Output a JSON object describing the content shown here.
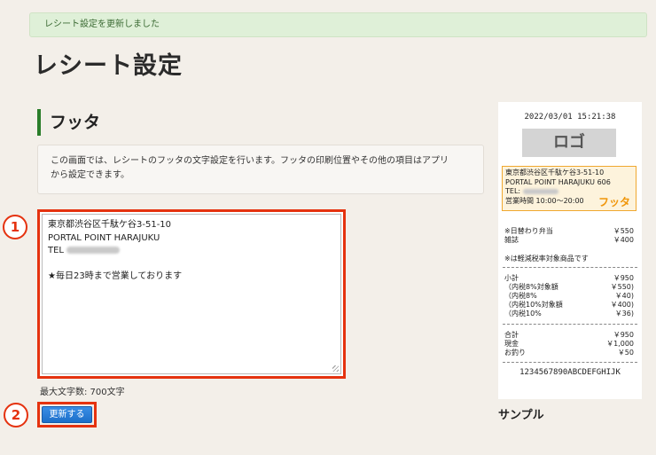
{
  "flash": {
    "message": "レシート設定を更新しました"
  },
  "page": {
    "title": "レシート設定"
  },
  "section": {
    "title": "フッタ",
    "description_line1": "この画面では、レシートのフッタの文字設定を行います。フッタの印刷位置やその他の項目はアプリ",
    "description_line2": "から設定できます。"
  },
  "footer_text": {
    "line1": "東京都渋谷区千駄ケ谷3-51-10",
    "line2": "PORTAL POINT HARAJUKU",
    "line3_prefix": "TEL",
    "line4": "",
    "line5": "★毎日23時まで営業しております",
    "max_chars_label": "最大文字数: 700文字"
  },
  "buttons": {
    "update": "更新する"
  },
  "annotations": {
    "badge1": "1",
    "badge2": "2"
  },
  "receipt": {
    "datetime": "2022/03/01 15:21:38",
    "logo": "ロゴ",
    "footer_line1": "東京都渋谷区千駄ケ谷3-51-10",
    "footer_line2": "PORTAL POINT HARAJUKU 606",
    "footer_line3": "TEL:",
    "footer_line4": "営業時間 10:00～20:00",
    "footer_tag": "フッタ",
    "items": [
      {
        "name": "※日替わり弁当",
        "price": "￥550"
      },
      {
        "name": "雑誌",
        "price": "￥400"
      }
    ],
    "tax_note": "※は軽減税率対象商品です",
    "totals": [
      {
        "name": "小計",
        "price": "￥950"
      },
      {
        "name": "（内税8%対象額",
        "price": "￥550)"
      },
      {
        "name": "（内税8%",
        "price": "￥40)"
      },
      {
        "name": "（内税10%対象額",
        "price": "￥400)"
      },
      {
        "name": "（内税10%",
        "price": "￥36)"
      }
    ],
    "payment": [
      {
        "name": "合計",
        "price": "￥950"
      },
      {
        "name": "現金",
        "price": "￥1,000"
      },
      {
        "name": "お釣り",
        "price": "￥50"
      }
    ],
    "barcode_text": "1234567890ABCDEFGHIJK"
  },
  "sample_label": "サンプル",
  "colors": {
    "accent_red": "#e5320f",
    "section_green": "#2a7d2a",
    "button_blue": "#1d6fc9",
    "footer_orange": "#f0a830"
  }
}
